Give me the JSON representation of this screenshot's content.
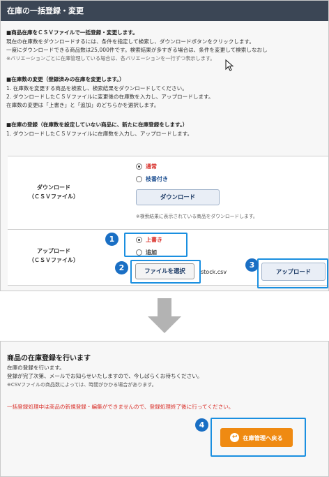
{
  "header": {
    "title": "在庫の一括登録・変更"
  },
  "section_bulk": {
    "heading": "■商品在庫をＣＳＶファイルで一括登録・変更します。",
    "lines": [
      "現在の在庫数をダウンロードするには、条件を指定して検索し、ダウンロードボタンをクリックします。",
      "一度にダウンロードできる商品数は25,000件です。検索結果が多すぎる場合は、条件を変更して検索しなおし"
    ],
    "note": "※バリエーションごとに在庫管理している場合は、各バリエーションを一行ずつ表示します。"
  },
  "section_change": {
    "heading": "■在庫数の変更（登録済みの在庫を変更します。）",
    "lines": [
      "1. 在庫数を変更する商品を検索し、検索結果をダウンロードしてください。",
      "2. ダウンロードしたＣＳＶファイルに変更後の在庫数を入力し、アップロードします。",
      "在庫数の変更は「上書き」と「追加」のどちらかを選択します。"
    ]
  },
  "section_register": {
    "heading": "■在庫の登録（在庫数を設定していない商品に、新たに在庫登録をします。）",
    "lines": [
      "1. ダウンロードしたＣＳＶファイルに在庫数を入力し、アップロードします。"
    ]
  },
  "download": {
    "label_line1": "ダウンロード",
    "label_line2": "（ＣＳＶファイル）",
    "option_normal": "通常",
    "option_branch": "枝番付き",
    "button": "ダウンロード",
    "note": "※検索結果に表示されている商品をダウンロードします。"
  },
  "upload": {
    "label_line1": "アップロード",
    "label_line2": "（ＣＳＶファイル）",
    "option_overwrite": "上書き",
    "option_add": "追加",
    "choose_file_button": "ファイルを選択",
    "filename": "stock.csv",
    "upload_button": "アップロード"
  },
  "badges": {
    "one": "1",
    "two": "2",
    "three": "3",
    "four": "4"
  },
  "result": {
    "title": "商品の在庫登録を行います",
    "line1": "在庫の登録を行います。",
    "line2": "登録が完了次第、メールでお知らせいたしますので、今しばらくお待ちください。",
    "note": "※CSVファイルの商品数によっては、時間がかかる場合があります。",
    "warning": "一括登録処理中は商品の新規登録・編集ができませんので、登録処理終了後に行ってください。",
    "button": "在庫管理へ戻る"
  },
  "colors": {
    "header": "#3b4655",
    "highlight": "#1a8fe0",
    "badge": "#1a6fc4",
    "orange": "#ef8a12",
    "red": "#d9302a"
  },
  "icons": {
    "cursor": "mouse-pointer-icon",
    "arrow": "down-arrow-icon",
    "return": "return-arrow-icon"
  }
}
